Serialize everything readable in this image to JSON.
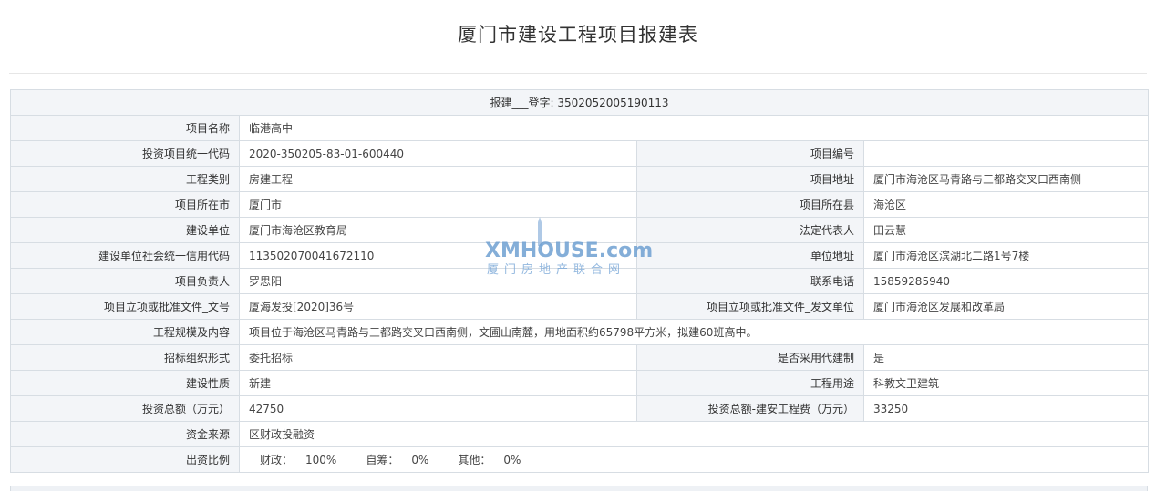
{
  "page": {
    "title": "厦门市建设工程项目报建表"
  },
  "header_row": "报建___登字: 350205200519011 3",
  "rows": {
    "project_name": {
      "label": "项目名称",
      "value": "临港高中"
    },
    "invest_code": {
      "label": "投资项目统一代码",
      "value": "2020-350205-83-01-600440",
      "label2": "项目编号",
      "value2": ""
    },
    "project_type": {
      "label": "工程类别",
      "value": "房建工程",
      "label2": "项目地址",
      "value2": "厦门市海沧区马青路与三都路交叉口西南侧"
    },
    "city": {
      "label": "项目所在市",
      "value": "厦门市",
      "label2": "项目所在县",
      "value2": "海沧区"
    },
    "builder": {
      "label": "建设单位",
      "value": "厦门市海沧区教育局",
      "label2": "法定代表人",
      "value2": "田云慧"
    },
    "credit_code": {
      "label": "建设单位社会统一信用代码",
      "value": "113502070041672110",
      "label2": "单位地址",
      "value2": "厦门市海沧区滨湖北二路1号7楼"
    },
    "manager": {
      "label": "项目负责人",
      "value": "罗思阳",
      "label2": "联系电话",
      "value2": "15859285940"
    },
    "approval": {
      "label": "项目立项或批准文件_文号",
      "value": "厦海发投[2020]36号",
      "label2": "项目立项或批准文件_发文单位",
      "value2": "厦门市海沧区发展和改革局"
    },
    "scale": {
      "label": "工程规模及内容",
      "value": "项目位于海沧区马青路与三都路交叉口西南侧，文圃山南麓，用地面积约65798平方米，拟建60班高中。"
    },
    "bidding": {
      "label": "招标组织形式",
      "value": "委托招标",
      "label2": "是否采用代建制",
      "value2": "是"
    },
    "nature": {
      "label": "建设性质",
      "value": "新建",
      "label2": "工程用途",
      "value2": "科教文卫建筑"
    },
    "investment": {
      "label": "投资总额（万元）",
      "value": "42750",
      "label2": "投资总额-建安工程费（万元）",
      "value2": "33250"
    },
    "funding": {
      "label": "资金来源",
      "value": "区财政投融资"
    },
    "ratio": {
      "label": "出资比例",
      "items": [
        {
          "k": "财政：",
          "v": "100%"
        },
        {
          "k": "自筹：",
          "v": "0%"
        },
        {
          "k": "其他：",
          "v": "0%"
        }
      ]
    }
  },
  "watermark": {
    "brand": "XMHOUSE.com",
    "sub": "厦门房地产联合网"
  },
  "colors": {
    "label_bg": "#f3f5f8",
    "border": "#d7dde3",
    "watermark": "#6fa0d2"
  }
}
